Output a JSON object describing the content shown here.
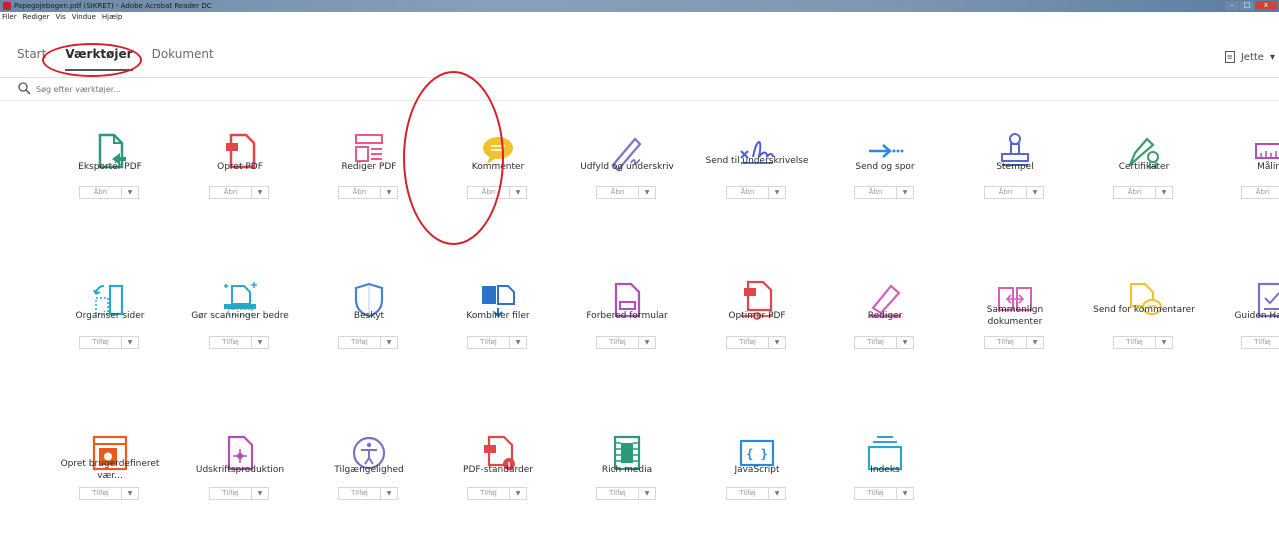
{
  "window": {
    "title": "Papegojebogen.pdf (SIKRET) - Adobe Acrobat Reader DC",
    "controls": [
      "–",
      "□",
      "x"
    ]
  },
  "menu": [
    "Filer",
    "Rediger",
    "Vis",
    "Vindue",
    "Hjælp"
  ],
  "tabs": [
    {
      "label": "Start"
    },
    {
      "label": "Værktøjer"
    },
    {
      "label": "Dokument"
    }
  ],
  "user": {
    "name": "Jette",
    "caret": "▾"
  },
  "search": {
    "placeholder": "Søg efter værktøjer..."
  },
  "tools": [
    {
      "name": "Eksportér PDF",
      "btn": "Åbn",
      "icon": "export-pdf-icon",
      "color": "#2a9a7a"
    },
    {
      "name": "Opret PDF",
      "btn": "Åbn",
      "icon": "create-pdf-icon",
      "color": "#e0474c"
    },
    {
      "name": "Rediger PDF",
      "btn": "Åbn",
      "icon": "edit-pdf-icon",
      "color": "#e45b8a"
    },
    {
      "name": "Kommenter",
      "btn": "Åbn",
      "icon": "comment-icon",
      "color": "#f2c22e"
    },
    {
      "name": "Udfyld og underskriv",
      "btn": "Åbn",
      "icon": "fill-sign-icon",
      "color": "#7e6fc9"
    },
    {
      "name": "Send til underskrivelse",
      "btn": "Åbn",
      "icon": "send-for-signature-icon",
      "color": "#4a5ed9"
    },
    {
      "name": "Send og spor",
      "btn": "Åbn",
      "icon": "send-track-icon",
      "color": "#2a8adf"
    },
    {
      "name": "Stempel",
      "btn": "Åbn",
      "icon": "stamp-icon",
      "color": "#5866cf"
    },
    {
      "name": "Certifikater",
      "btn": "Åbn",
      "icon": "certificate-icon",
      "color": "#3e9b6a"
    },
    {
      "name": "Måling",
      "btn": "Åbn",
      "icon": "measure-icon",
      "color": "#b04fb5"
    },
    {
      "name": "Organiser sider",
      "btn": "Tilføj",
      "icon": "organize-pages-icon",
      "color": "#2aa6c9"
    },
    {
      "name": "Gør scanninger bedre",
      "btn": "Tilføj",
      "icon": "enhance-scan-icon",
      "color": "#2aa6c9"
    },
    {
      "name": "Beskyt",
      "btn": "Tilføj",
      "icon": "protect-shield-icon",
      "color": "#4a7fd6"
    },
    {
      "name": "Kombiner filer",
      "btn": "Tilføj",
      "icon": "combine-files-icon",
      "color": "#2a73c9"
    },
    {
      "name": "Forbered formular",
      "btn": "Tilføj",
      "icon": "prepare-form-icon",
      "color": "#b04fb5"
    },
    {
      "name": "Optimer PDF",
      "btn": "Tilføj",
      "icon": "optimize-pdf-icon",
      "color": "#e0474c"
    },
    {
      "name": "Rediger",
      "btn": "Tilføj",
      "icon": "redact-icon",
      "color": "#d65fb8"
    },
    {
      "name": "Sammenlign dokumenter",
      "btn": "Tilføj",
      "icon": "compare-icon",
      "color": "#d65fb8"
    },
    {
      "name": "Send for kommentarer",
      "btn": "Tilføj",
      "icon": "send-comments-icon",
      "color": "#f2c22e"
    },
    {
      "name": "Guiden Handling",
      "btn": "Tilføj",
      "icon": "action-wizard-icon",
      "color": "#7e6fc9"
    },
    {
      "name": "Opret brugerdefineret vær...",
      "btn": "Tilføj",
      "icon": "custom-tool-icon",
      "color": "#e85a1f"
    },
    {
      "name": "Udskriftsproduktion",
      "btn": "Tilføj",
      "icon": "print-production-icon",
      "color": "#b04fb5"
    },
    {
      "name": "Tilgængelighed",
      "btn": "Tilføj",
      "icon": "accessibility-icon",
      "color": "#7e6fc9"
    },
    {
      "name": "PDF-standarder",
      "btn": "Tilføj",
      "icon": "pdf-standards-icon",
      "color": "#e0474c"
    },
    {
      "name": "Rich media",
      "btn": "Tilføj",
      "icon": "rich-media-icon",
      "color": "#2a9a7a"
    },
    {
      "name": "JavaScript",
      "btn": "Tilføj",
      "icon": "javascript-icon",
      "color": "#2a8adf"
    },
    {
      "name": "Indeks",
      "btn": "Tilføj",
      "icon": "index-icon",
      "color": "#2aa6c9"
    }
  ]
}
